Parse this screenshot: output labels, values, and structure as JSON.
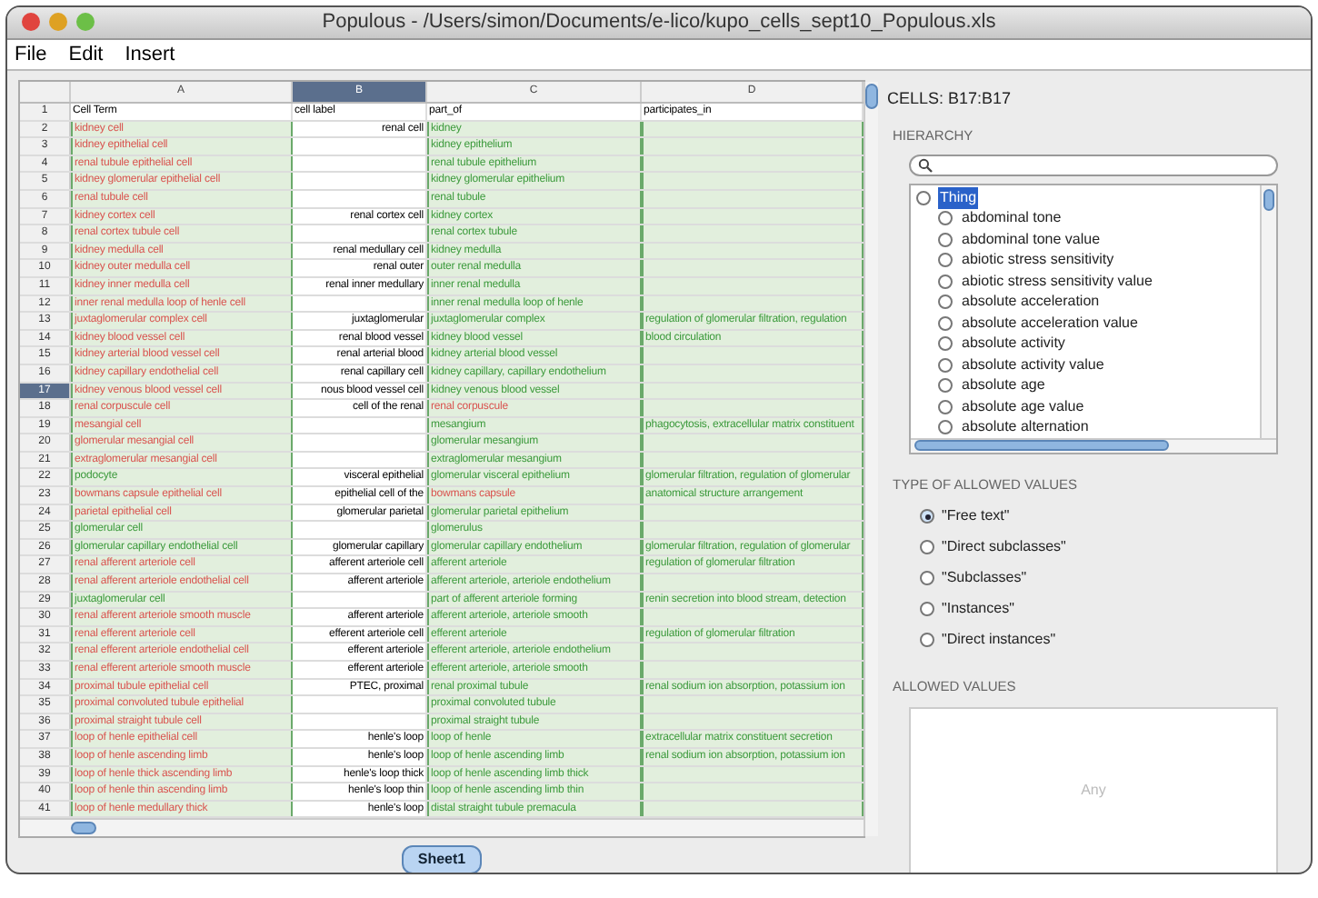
{
  "window": {
    "title": "Populous - /Users/simon/Documents/e-lico/kupo_cells_sept10_Populous.xls"
  },
  "menu": [
    "File",
    "Edit",
    "Insert"
  ],
  "sheet": {
    "columns": [
      {
        "label": "A",
        "selected": false,
        "validated": true
      },
      {
        "label": "B",
        "selected": true,
        "validated": false
      },
      {
        "label": "C",
        "selected": false,
        "validated": true
      },
      {
        "label": "D",
        "selected": false,
        "validated": true
      }
    ],
    "rows": [
      {
        "n": "1",
        "kind": "header",
        "selected": false,
        "cells": [
          {
            "text": "Cell Term"
          },
          {
            "text": "cell label"
          },
          {
            "text": "part_of"
          },
          {
            "text": "participates_in"
          }
        ]
      },
      {
        "n": "2",
        "kind": "data",
        "selected": false,
        "cells": [
          {
            "text": "kidney cell",
            "valid": false
          },
          {
            "text": "renal cell"
          },
          {
            "text": "kidney",
            "valid": true
          },
          {}
        ]
      },
      {
        "n": "3",
        "kind": "data",
        "selected": false,
        "cells": [
          {
            "text": "kidney epithelial cell",
            "valid": false
          },
          {},
          {
            "text": "kidney epithelium",
            "valid": true
          },
          {}
        ]
      },
      {
        "n": "4",
        "kind": "data",
        "selected": false,
        "cells": [
          {
            "text": "renal tubule epithelial cell",
            "valid": false
          },
          {},
          {
            "text": "renal tubule epithelium",
            "valid": true
          },
          {}
        ]
      },
      {
        "n": "5",
        "kind": "data",
        "selected": false,
        "cells": [
          {
            "text": "kidney glomerular epithelial cell",
            "valid": false
          },
          {},
          {
            "text": "kidney glomerular epithelium",
            "valid": true
          },
          {}
        ]
      },
      {
        "n": "6",
        "kind": "data",
        "selected": false,
        "cells": [
          {
            "text": "renal tubule cell",
            "valid": false
          },
          {},
          {
            "text": "renal tubule",
            "valid": true
          },
          {}
        ]
      },
      {
        "n": "7",
        "kind": "data",
        "selected": false,
        "cells": [
          {
            "text": "kidney cortex cell",
            "valid": false
          },
          {
            "text": "renal cortex cell"
          },
          {
            "text": "kidney cortex",
            "valid": true
          },
          {}
        ]
      },
      {
        "n": "8",
        "kind": "data",
        "selected": false,
        "cells": [
          {
            "text": "renal cortex tubule cell",
            "valid": false
          },
          {},
          {
            "text": "renal cortex tubule",
            "valid": true
          },
          {}
        ]
      },
      {
        "n": "9",
        "kind": "data",
        "selected": false,
        "cells": [
          {
            "text": "kidney medulla cell",
            "valid": false
          },
          {
            "text": "renal medullary cell"
          },
          {
            "text": "kidney medulla",
            "valid": true
          },
          {}
        ]
      },
      {
        "n": "10",
        "kind": "data",
        "selected": false,
        "cells": [
          {
            "text": "kidney outer medulla cell",
            "valid": false
          },
          {
            "text": "renal outer"
          },
          {
            "text": "outer renal medulla",
            "valid": true
          },
          {}
        ]
      },
      {
        "n": "11",
        "kind": "data",
        "selected": false,
        "cells": [
          {
            "text": "kidney inner medulla cell",
            "valid": false
          },
          {
            "text": "renal inner medullary"
          },
          {
            "text": "inner renal medulla",
            "valid": true
          },
          {}
        ]
      },
      {
        "n": "12",
        "kind": "data",
        "selected": false,
        "cells": [
          {
            "text": "inner renal medulla loop of henle cell",
            "valid": false
          },
          {},
          {
            "text": "inner renal medulla loop of henle",
            "valid": true
          },
          {}
        ]
      },
      {
        "n": "13",
        "kind": "data",
        "selected": false,
        "cells": [
          {
            "text": "juxtaglomerular complex cell",
            "valid": false
          },
          {
            "text": "juxtaglomerular"
          },
          {
            "text": "juxtaglomerular complex",
            "valid": true
          },
          {
            "text": "regulation of glomerular filtration, regulation",
            "valid": true
          }
        ]
      },
      {
        "n": "14",
        "kind": "data",
        "selected": false,
        "cells": [
          {
            "text": "kidney blood vessel cell",
            "valid": false
          },
          {
            "text": "renal blood vessel"
          },
          {
            "text": "kidney blood vessel",
            "valid": true
          },
          {
            "text": "blood circulation",
            "valid": true
          }
        ]
      },
      {
        "n": "15",
        "kind": "data",
        "selected": false,
        "cells": [
          {
            "text": "kidney arterial blood vessel cell",
            "valid": false
          },
          {
            "text": "renal arterial blood"
          },
          {
            "text": "kidney arterial blood vessel",
            "valid": true
          },
          {}
        ]
      },
      {
        "n": "16",
        "kind": "data",
        "selected": false,
        "cells": [
          {
            "text": "kidney capillary endothelial cell",
            "valid": false
          },
          {
            "text": "renal capillary cell"
          },
          {
            "text": "kidney capillary, capillary endothelium",
            "valid": true
          },
          {}
        ]
      },
      {
        "n": "17",
        "kind": "data",
        "selected": true,
        "cells": [
          {
            "text": "kidney venous blood vessel cell",
            "valid": false
          },
          {
            "text": "nous blood vessel cell"
          },
          {
            "text": "kidney venous blood vessel",
            "valid": true
          },
          {}
        ]
      },
      {
        "n": "18",
        "kind": "data",
        "selected": false,
        "cells": [
          {
            "text": "renal corpuscule cell",
            "valid": false
          },
          {
            "text": "cell of the renal"
          },
          {
            "text": "renal corpuscule",
            "valid": false
          },
          {}
        ]
      },
      {
        "n": "19",
        "kind": "data",
        "selected": false,
        "cells": [
          {
            "text": "mesangial cell",
            "valid": false
          },
          {},
          {
            "text": "mesangium",
            "valid": true
          },
          {
            "text": "phagocytosis, extracellular matrix constituent",
            "valid": true
          }
        ]
      },
      {
        "n": "20",
        "kind": "data",
        "selected": false,
        "cells": [
          {
            "text": "glomerular mesangial cell",
            "valid": false
          },
          {},
          {
            "text": "glomerular mesangium",
            "valid": true
          },
          {}
        ]
      },
      {
        "n": "21",
        "kind": "data",
        "selected": false,
        "cells": [
          {
            "text": "extraglomerular mesangial cell",
            "valid": false
          },
          {},
          {
            "text": "extraglomerular mesangium",
            "valid": true
          },
          {}
        ]
      },
      {
        "n": "22",
        "kind": "data",
        "selected": false,
        "cells": [
          {
            "text": "podocyte",
            "valid": true
          },
          {
            "text": "visceral epithelial"
          },
          {
            "text": "glomerular visceral epithelium",
            "valid": true
          },
          {
            "text": "glomerular filtration, regulation of glomerular",
            "valid": true
          }
        ]
      },
      {
        "n": "23",
        "kind": "data",
        "selected": false,
        "cells": [
          {
            "text": "bowmans capsule epithelial cell",
            "valid": false
          },
          {
            "text": "epithelial cell of the"
          },
          {
            "text": "bowmans capsule",
            "valid": false
          },
          {
            "text": "anatomical structure arrangement",
            "valid": true
          }
        ]
      },
      {
        "n": "24",
        "kind": "data",
        "selected": false,
        "cells": [
          {
            "text": "parietal epithelial cell",
            "valid": false
          },
          {
            "text": "glomerular parietal"
          },
          {
            "text": "glomerular parietal epithelium",
            "valid": true
          },
          {}
        ]
      },
      {
        "n": "25",
        "kind": "data",
        "selected": false,
        "cells": [
          {
            "text": "glomerular cell",
            "valid": true
          },
          {},
          {
            "text": "glomerulus",
            "valid": true
          },
          {}
        ]
      },
      {
        "n": "26",
        "kind": "data",
        "selected": false,
        "cells": [
          {
            "text": "glomerular capillary endothelial cell",
            "valid": true
          },
          {
            "text": "glomerular capillary"
          },
          {
            "text": "glomerular capillary endothelium",
            "valid": true
          },
          {
            "text": "glomerular filtration, regulation of glomerular",
            "valid": true
          }
        ]
      },
      {
        "n": "27",
        "kind": "data",
        "selected": false,
        "cells": [
          {
            "text": "renal afferent arteriole cell",
            "valid": false
          },
          {
            "text": "afferent arteriole cell"
          },
          {
            "text": "afferent arteriole",
            "valid": true
          },
          {
            "text": "regulation of glomerular filtration",
            "valid": true
          }
        ]
      },
      {
        "n": "28",
        "kind": "data",
        "selected": false,
        "cells": [
          {
            "text": "renal afferent arteriole endothelial cell",
            "valid": false
          },
          {
            "text": "afferent arteriole"
          },
          {
            "text": "afferent arteriole, arteriole endothelium",
            "valid": true
          },
          {}
        ]
      },
      {
        "n": "29",
        "kind": "data",
        "selected": false,
        "cells": [
          {
            "text": "juxtaglomerular cell",
            "valid": true
          },
          {},
          {
            "text": "part of afferent arteriole forming",
            "valid": true
          },
          {
            "text": "renin secretion into blood stream, detection",
            "valid": true
          }
        ]
      },
      {
        "n": "30",
        "kind": "data",
        "selected": false,
        "cells": [
          {
            "text": "renal afferent arteriole smooth muscle",
            "valid": false
          },
          {
            "text": "afferent arteriole"
          },
          {
            "text": "afferent arteriole, arteriole smooth",
            "valid": true
          },
          {}
        ]
      },
      {
        "n": "31",
        "kind": "data",
        "selected": false,
        "cells": [
          {
            "text": "renal efferent arteriole cell",
            "valid": false
          },
          {
            "text": "efferent arteriole cell"
          },
          {
            "text": "efferent arteriole",
            "valid": true
          },
          {
            "text": "regulation of glomerular filtration",
            "valid": true
          }
        ]
      },
      {
        "n": "32",
        "kind": "data",
        "selected": false,
        "cells": [
          {
            "text": "renal efferent arteriole endothelial cell",
            "valid": false
          },
          {
            "text": "efferent arteriole"
          },
          {
            "text": "efferent arteriole, arteriole endothelium",
            "valid": true
          },
          {}
        ]
      },
      {
        "n": "33",
        "kind": "data",
        "selected": false,
        "cells": [
          {
            "text": "renal efferent arteriole smooth muscle",
            "valid": false
          },
          {
            "text": "efferent arteriole"
          },
          {
            "text": "efferent arteriole, arteriole smooth",
            "valid": true
          },
          {}
        ]
      },
      {
        "n": "34",
        "kind": "data",
        "selected": false,
        "cells": [
          {
            "text": "proximal tubule epithelial cell",
            "valid": false
          },
          {
            "text": "PTEC, proximal"
          },
          {
            "text": "renal proximal tubule",
            "valid": true
          },
          {
            "text": "renal sodium ion absorption, potassium ion",
            "valid": true
          }
        ]
      },
      {
        "n": "35",
        "kind": "data",
        "selected": false,
        "cells": [
          {
            "text": "proximal convoluted tubule epithelial",
            "valid": false
          },
          {},
          {
            "text": "proximal convoluted tubule",
            "valid": true
          },
          {}
        ]
      },
      {
        "n": "36",
        "kind": "data",
        "selected": false,
        "cells": [
          {
            "text": "proximal straight tubule cell",
            "valid": false
          },
          {},
          {
            "text": "proximal straight tubule",
            "valid": true
          },
          {}
        ]
      },
      {
        "n": "37",
        "kind": "data",
        "selected": false,
        "cells": [
          {
            "text": "loop of henle epithelial cell",
            "valid": false
          },
          {
            "text": "henle's loop"
          },
          {
            "text": "loop of henle",
            "valid": true
          },
          {
            "text": "extracellular matrix constituent secretion",
            "valid": true
          }
        ]
      },
      {
        "n": "38",
        "kind": "data",
        "selected": false,
        "cells": [
          {
            "text": "loop of henle ascending limb",
            "valid": false
          },
          {
            "text": "henle's loop"
          },
          {
            "text": "loop of henle ascending limb",
            "valid": true
          },
          {
            "text": "renal sodium ion absorption, potassium ion",
            "valid": true
          }
        ]
      },
      {
        "n": "39",
        "kind": "data",
        "selected": false,
        "cells": [
          {
            "text": "loop of henle thick ascending limb",
            "valid": false
          },
          {
            "text": "henle's loop thick"
          },
          {
            "text": "loop of henle ascending limb thick",
            "valid": true
          },
          {}
        ]
      },
      {
        "n": "40",
        "kind": "data",
        "selected": false,
        "cells": [
          {
            "text": "loop of henle thin ascending limb",
            "valid": false
          },
          {
            "text": "henle's loop thin"
          },
          {
            "text": "loop of henle ascending limb thin",
            "valid": true
          },
          {}
        ]
      },
      {
        "n": "41",
        "kind": "data",
        "selected": false,
        "cells": [
          {
            "text": "loop of henle medullary thick",
            "valid": false
          },
          {
            "text": "henle's loop"
          },
          {
            "text": "distal straight tubule premacula",
            "valid": true
          },
          {}
        ]
      }
    ],
    "sheet_tabs": [
      {
        "label": "Sheet1",
        "selected": true
      }
    ]
  },
  "panel": {
    "cells_label": "CELLS: B17:B17",
    "hierarchy_heading": "HIERARCHY",
    "tree": [
      {
        "label": "Thing",
        "selected": true,
        "checked": false,
        "children": [
          {
            "label": "abdominal tone",
            "selected": false,
            "checked": false
          },
          {
            "label": "abdominal tone value",
            "selected": false,
            "checked": false
          },
          {
            "label": "abiotic stress sensitivity",
            "selected": false,
            "checked": false
          },
          {
            "label": "abiotic stress sensitivity value",
            "selected": false,
            "checked": false
          },
          {
            "label": "absolute acceleration",
            "selected": false,
            "checked": false
          },
          {
            "label": "absolute acceleration value",
            "selected": false,
            "checked": false
          },
          {
            "label": "absolute activity",
            "selected": false,
            "checked": false
          },
          {
            "label": "absolute activity value",
            "selected": false,
            "checked": false
          },
          {
            "label": "absolute age",
            "selected": false,
            "checked": false
          },
          {
            "label": "absolute age value",
            "selected": false,
            "checked": false
          },
          {
            "label": "absolute alternation",
            "selected": false,
            "checked": false
          }
        ]
      }
    ],
    "types_heading": "TYPE OF ALLOWED VALUES",
    "types": [
      {
        "label": "\"Free text\"",
        "selected": true
      },
      {
        "label": "\"Direct subclasses\"",
        "selected": false
      },
      {
        "label": "\"Subclasses\"",
        "selected": false
      },
      {
        "label": "\"Instances\"",
        "selected": false
      },
      {
        "label": "\"Direct instances\"",
        "selected": false
      }
    ],
    "allowed_heading": "ALLOWED VALUES",
    "allowed_placeholder": "Any"
  }
}
